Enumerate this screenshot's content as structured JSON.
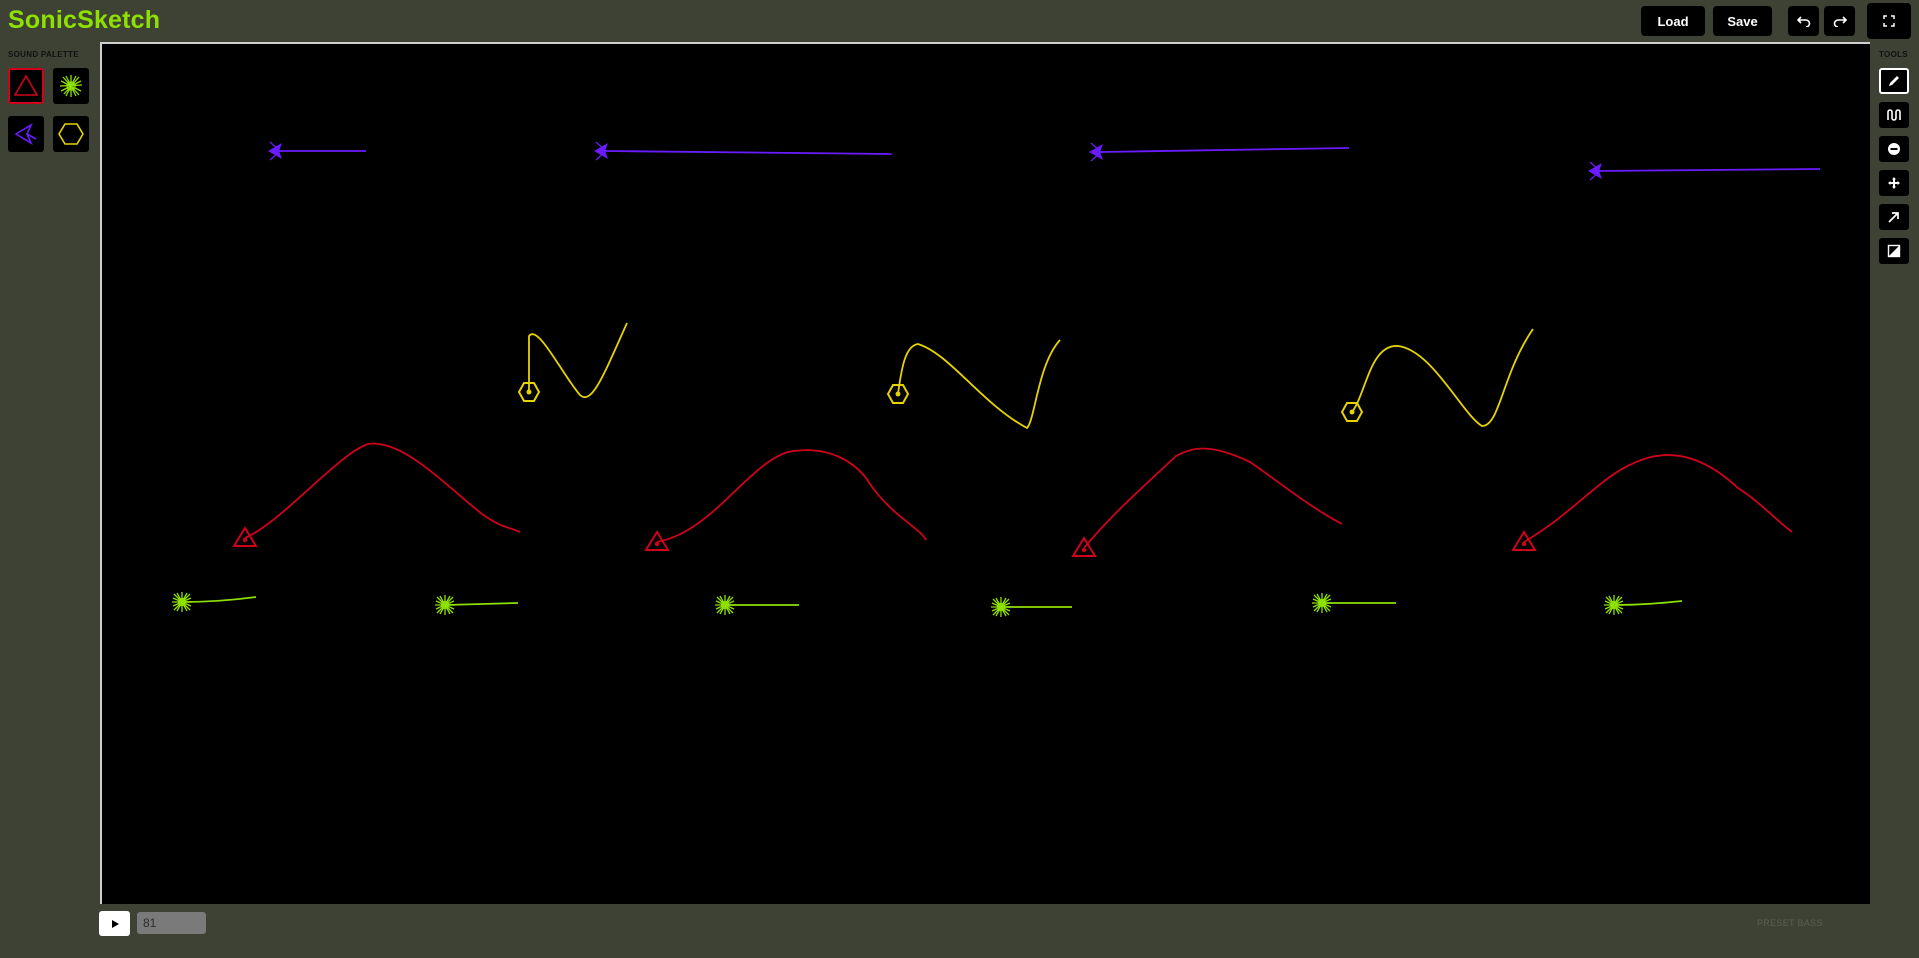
{
  "app": {
    "title": "SonicSketch"
  },
  "header": {
    "load_label": "Load",
    "save_label": "Save",
    "undo_icon": "undo-icon",
    "redo_icon": "redo-icon",
    "fullscreen_icon": "fullscreen-icon"
  },
  "palette": {
    "title": "SOUND PALETTE",
    "items": [
      {
        "icon": "triangle-icon",
        "color": "#d0021b",
        "selected": true
      },
      {
        "icon": "burst-icon",
        "color": "#8ee000",
        "selected": false
      },
      {
        "icon": "arrowhead-icon",
        "color": "#6a1cff",
        "selected": false
      },
      {
        "icon": "hexagon-icon",
        "color": "#e6d300",
        "selected": false
      }
    ]
  },
  "tools": {
    "title": "TOOLS",
    "items": [
      {
        "icon": "pencil-icon",
        "active": true
      },
      {
        "icon": "waveform-icon",
        "active": false
      },
      {
        "icon": "minus-circle-icon",
        "active": false
      },
      {
        "icon": "move-icon",
        "active": false
      },
      {
        "icon": "arrow-icon",
        "active": false
      },
      {
        "icon": "contrast-icon",
        "active": false
      }
    ]
  },
  "colors": {
    "purple": "#6a1cff",
    "yellow": "#e6d300",
    "red": "#d0021b",
    "green": "#8ee000"
  },
  "footer": {
    "play_icon": "play-icon",
    "tempo_value": "81",
    "preset_label": "PRESET BASS"
  }
}
